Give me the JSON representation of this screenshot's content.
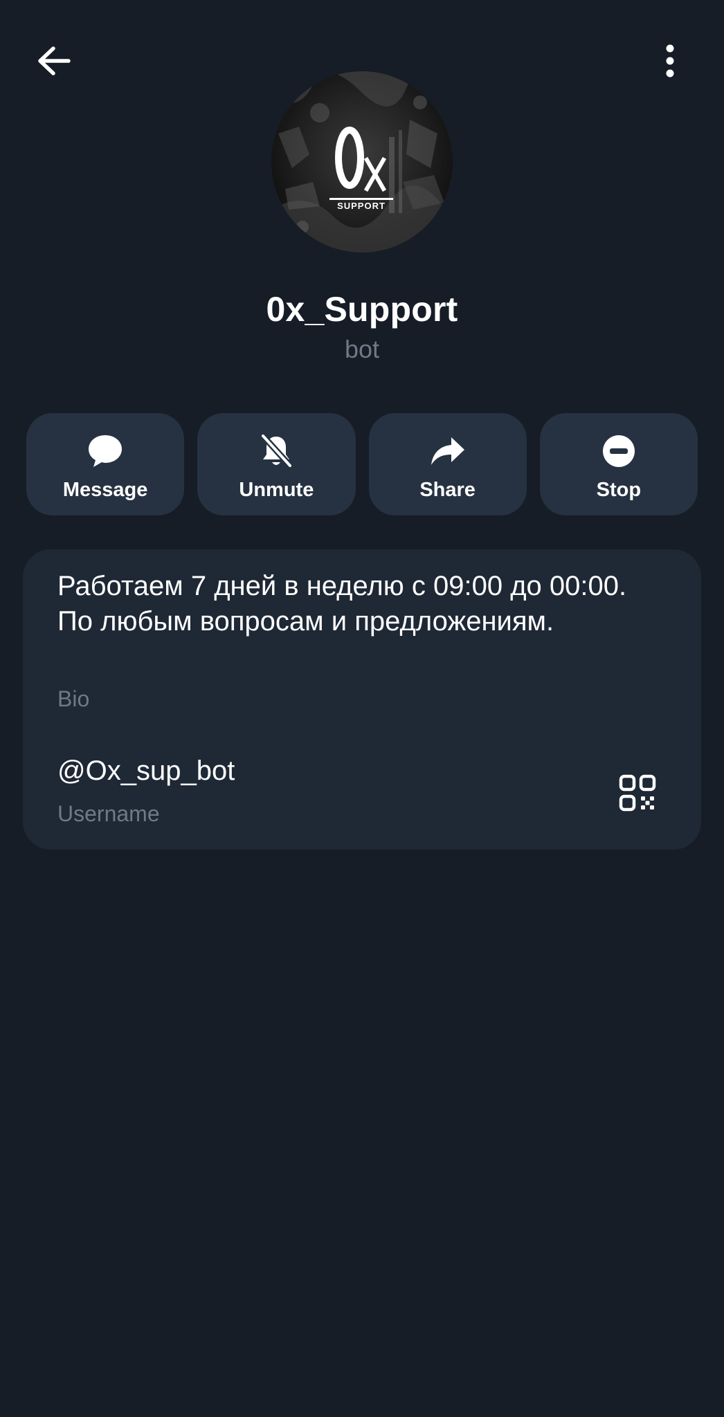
{
  "profile": {
    "name": "0x_Support",
    "subtitle": "bot",
    "avatar_logo_text": "0x",
    "avatar_logo_subtext": "SUPPORT"
  },
  "topbar": {
    "back_icon": "arrow-left-icon",
    "menu_icon": "more-vertical-icon"
  },
  "actions": [
    {
      "label": "Message",
      "icon": "chat-bubble-icon"
    },
    {
      "label": "Unmute",
      "icon": "bell-off-icon"
    },
    {
      "label": "Share",
      "icon": "share-arrow-icon"
    },
    {
      "label": "Stop",
      "icon": "stop-circle-icon"
    }
  ],
  "info": {
    "bio": "Работаем 7 дней в неделю с 09:00 до 00:00. По любым вопросам и предложениям.",
    "bio_label": "Bio",
    "username": "@Ox_sup_bot",
    "username_label": "Username",
    "qr_icon": "qr-code-icon"
  },
  "colors": {
    "background": "#161d27",
    "button_bg": "#263241",
    "card_bg": "#1f2835",
    "secondary_text": "#6e7a87"
  }
}
